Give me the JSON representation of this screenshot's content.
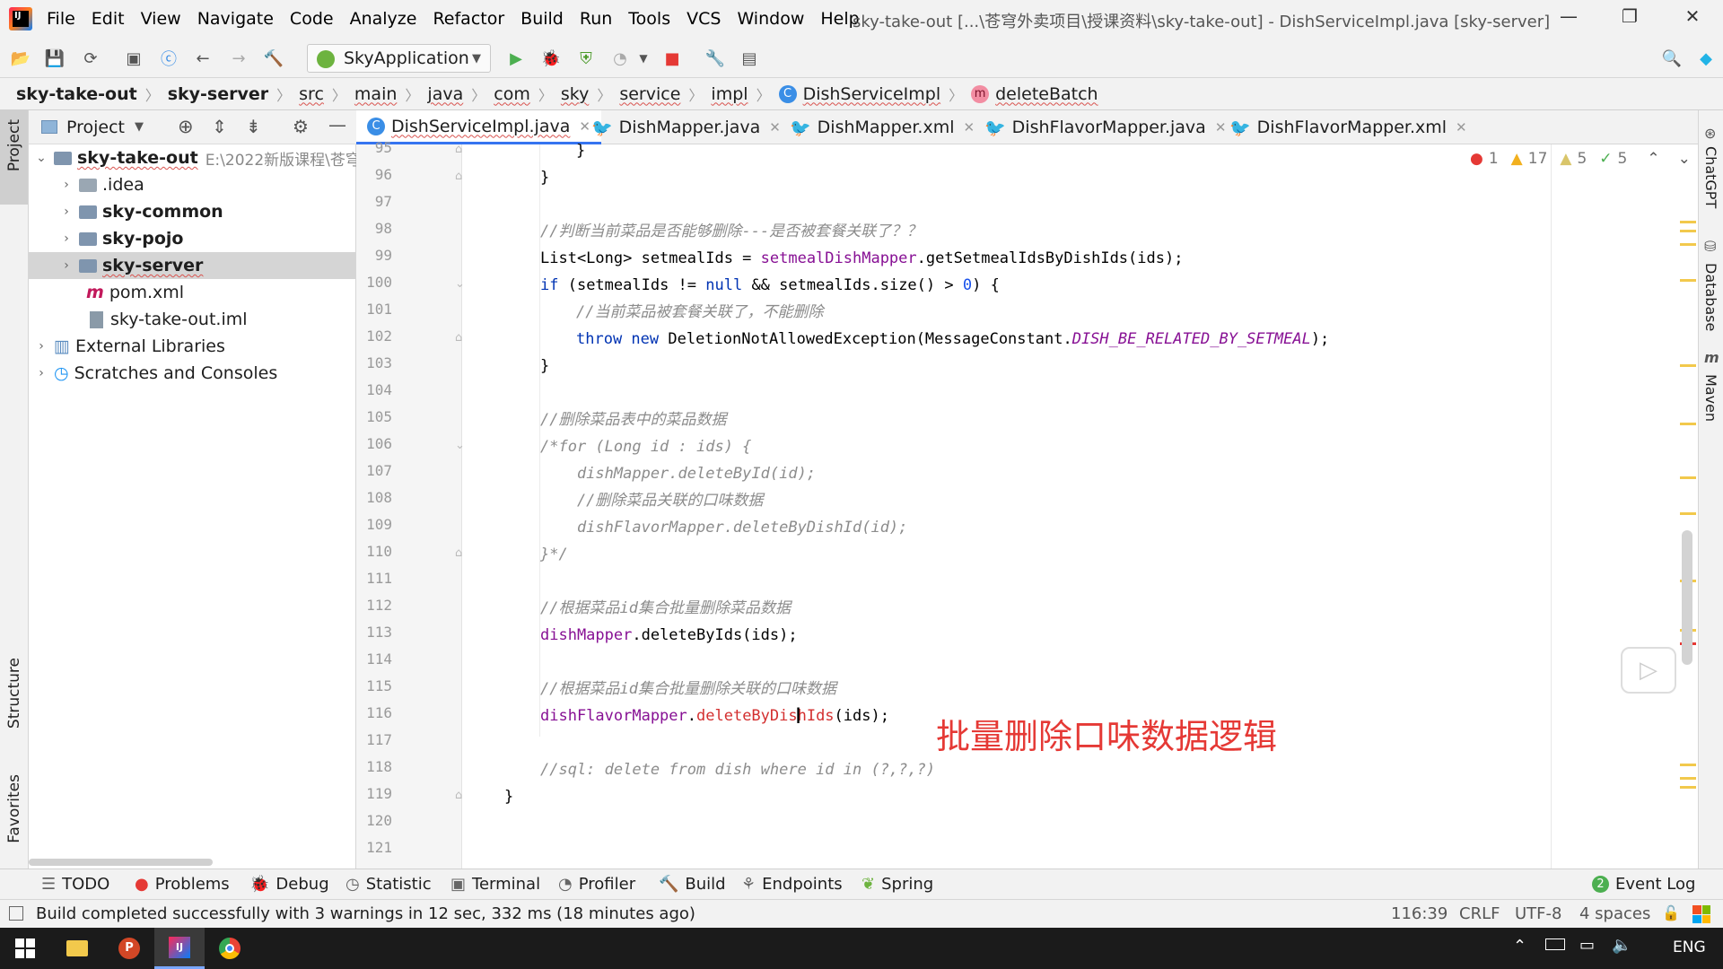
{
  "window": {
    "title": "sky-take-out [...\\苍穹外卖项目\\授课资料\\sky-take-out] - DishServiceImpl.java [sky-server]",
    "menu": [
      "File",
      "Edit",
      "View",
      "Navigate",
      "Code",
      "Analyze",
      "Refactor",
      "Build",
      "Run",
      "Tools",
      "VCS",
      "Window",
      "Help"
    ]
  },
  "toolbar": {
    "run_config": "SkyApplication"
  },
  "breadcrumb": [
    "sky-take-out",
    "sky-server",
    "src",
    "main",
    "java",
    "com",
    "sky",
    "service",
    "impl",
    "DishServiceImpl",
    "deleteBatch"
  ],
  "left_strip": {
    "project": "Project",
    "structure": "Structure",
    "favorites": "Favorites"
  },
  "project": {
    "header": "Project",
    "root": {
      "name": "sky-take-out",
      "path": "E:\\2022新版课程\\苍穹"
    },
    "items": [
      ".idea",
      "sky-common",
      "sky-pojo",
      "sky-server",
      "pom.xml",
      "sky-take-out.iml"
    ],
    "external": "External Libraries",
    "scratches": "Scratches and Consoles"
  },
  "tabs": [
    "DishServiceImpl.java",
    "DishMapper.java",
    "DishMapper.xml",
    "DishFlavorMapper.java",
    "DishFlavorMapper.xml"
  ],
  "inspections": {
    "errors": "1",
    "warnings": "17",
    "weak": "5",
    "ok": "5"
  },
  "line_numbers": [
    "95",
    "96",
    "97",
    "98",
    "99",
    "100",
    "101",
    "102",
    "103",
    "104",
    "105",
    "106",
    "107",
    "108",
    "109",
    "110",
    "111",
    "112",
    "113",
    "114",
    "115",
    "116",
    "117",
    "118",
    "119",
    "120",
    "121"
  ],
  "code": {
    "c98": "//判断当前菜品是否能够删除---是否被套餐关联了？？",
    "c101": "//当前菜品被套餐关联了，不能删除",
    "c105": "//删除菜品表中的菜品数据",
    "c106": "/*for (Long id : ids) {",
    "c107": "    dishMapper.deleteById(id);",
    "c108": "    //删除菜品关联的口味数据",
    "c109": "    dishFlavorMapper.deleteByDishId(id);",
    "c110": "}*/",
    "c112": "//根据菜品id集合批量删除菜品数据",
    "c115": "//根据菜品id集合批量删除关联的口味数据",
    "c118": "//sql: delete from dish where id in (?,?,?)"
  },
  "annotation": "批量删除口味数据逻辑",
  "right_strip": [
    "ChatGPT",
    "Database",
    "Maven"
  ],
  "bottom_tabs": [
    "TODO",
    "Problems",
    "Debug",
    "Statistic",
    "Terminal",
    "Profiler",
    "Build",
    "Endpoints",
    "Spring"
  ],
  "event_log": {
    "count": "2",
    "label": "Event Log"
  },
  "status": {
    "message": "Build completed successfully with 3 warnings in 12 sec, 332 ms (18 minutes ago)",
    "position": "116:39",
    "line_sep": "CRLF",
    "encoding": "UTF-8",
    "indent": "4 spaces"
  },
  "taskbar": {
    "lang": "ENG"
  },
  "colors": {
    "accent": "#3574f0",
    "annotation": "#e53935",
    "keyword": "#0033b3",
    "field": "#871094",
    "comment": "#8c8c8c"
  }
}
